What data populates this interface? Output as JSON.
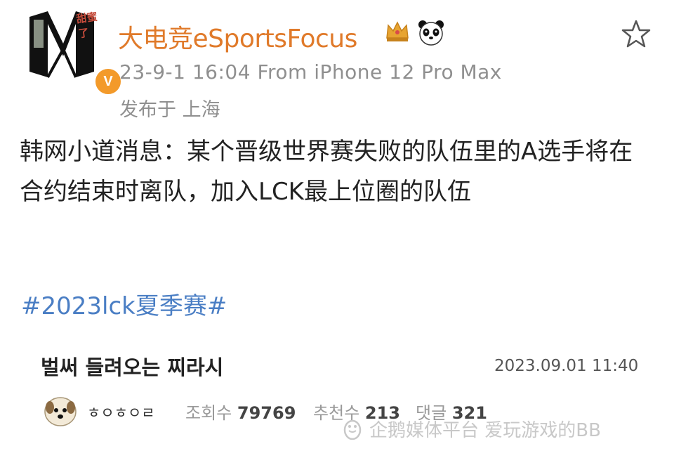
{
  "post": {
    "avatar_tag": "甜蜜了",
    "verify_badge": "V",
    "author_name": "大电竞eSportsFocus",
    "meta_line": "23-9-1 16:04 From iPhone 12 Pro Max",
    "location": "发布于 上海",
    "text": "韩网小道消息：某个晋级世界赛失败的队伍里的A选手将在合约结束时离队，加入LCK最上位圈的队伍",
    "hashtag": "#2023lck夏季赛#"
  },
  "comment": {
    "text": "벌써 들려오는 찌라시",
    "date": "2023.09.01 11:40",
    "commenter_name": "ㅎㅇㅎㅇㄹ",
    "views_label": "조회수",
    "views_value": "79769",
    "recommend_label": "추천수",
    "recommend_value": "213",
    "replies_label": "댓글",
    "replies_value": "321"
  },
  "watermark": "企鹅媒体平台 爱玩游戏的BB",
  "icons": {
    "favorite": "star-outline-icon",
    "crown": "crown-icon",
    "panda": "panda-icon",
    "watermark": "penguin-logo-icon"
  },
  "colors": {
    "author": "#e07a2a",
    "hashtag": "#4a7ec4",
    "meta": "#8f8f8f",
    "badge": "#f39a2a"
  }
}
